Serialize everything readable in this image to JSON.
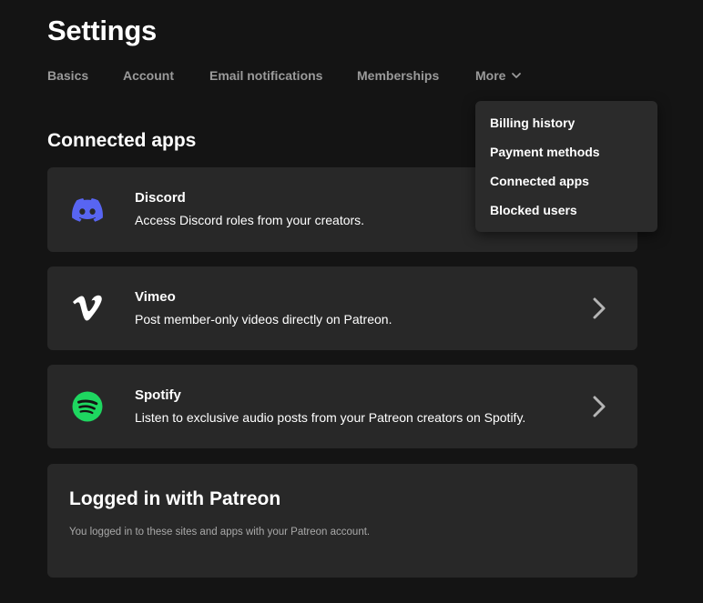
{
  "page": {
    "title": "Settings"
  },
  "tabs": [
    {
      "label": "Basics"
    },
    {
      "label": "Account"
    },
    {
      "label": "Email notifications"
    },
    {
      "label": "Memberships"
    },
    {
      "label": "More"
    }
  ],
  "dropdown": {
    "items": [
      {
        "label": "Billing history"
      },
      {
        "label": "Payment methods"
      },
      {
        "label": "Connected apps"
      },
      {
        "label": "Blocked users"
      }
    ]
  },
  "connected_apps": {
    "title": "Connected apps",
    "apps": [
      {
        "name": "Discord",
        "description": "Access Discord roles from your creators.",
        "icon": "discord-icon",
        "color": "#5865f2"
      },
      {
        "name": "Vimeo",
        "description": "Post member-only videos directly on Patreon.",
        "icon": "vimeo-icon",
        "color": "#ffffff"
      },
      {
        "name": "Spotify",
        "description": "Listen to exclusive audio posts from your Patreon creators on Spotify.",
        "icon": "spotify-icon",
        "color": "#1ed760"
      }
    ]
  },
  "logged_in": {
    "title": "Logged in with Patreon",
    "description": "You logged in to these sites and apps with your Patreon account."
  },
  "colors": {
    "background": "#141414",
    "card": "#282828",
    "dropdown": "#2b2b2b",
    "tab_text": "#9a9a9a",
    "muted_text": "#a9a9a9"
  }
}
